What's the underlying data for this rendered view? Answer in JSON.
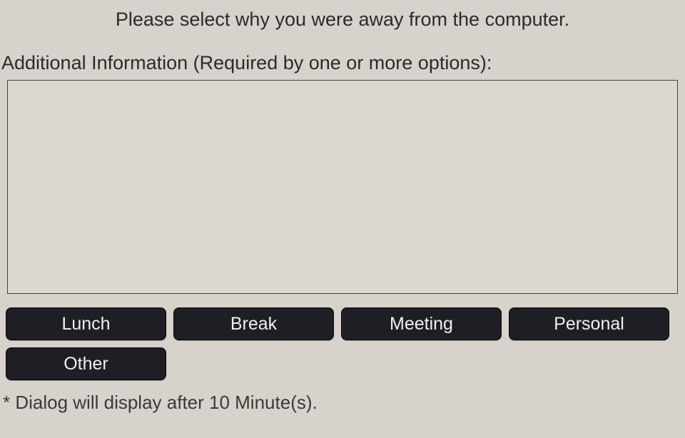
{
  "title": "Please select why you were away from the computer.",
  "additional_label": "Additional Information (Required by one or more options):",
  "additional_value": "",
  "reasons": {
    "lunch": "Lunch",
    "break": "Break",
    "meeting": "Meeting",
    "personal": "Personal",
    "other": "Other"
  },
  "footnote": "* Dialog will display after 10 Minute(s)."
}
